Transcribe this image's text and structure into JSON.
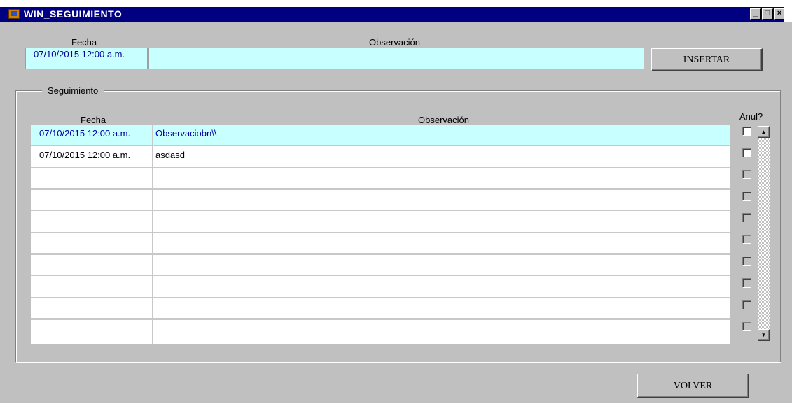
{
  "window": {
    "title": "WIN_SEGUIMIENTO",
    "minimize": "_",
    "maximize": "□",
    "close": "×"
  },
  "form": {
    "fecha_label": "Fecha",
    "observacion_label": "Observación",
    "fecha_value": "07/10/2015 12:00 a.m.",
    "observacion_value": "",
    "insert_button": "INSERTAR"
  },
  "seguimiento": {
    "group_label": "Seguimiento",
    "columns": {
      "fecha": "Fecha",
      "observacion": "Observación",
      "anulado": "Anul?"
    },
    "rows": [
      {
        "fecha": "07/10/2015 12:00 a.m.",
        "observacion": "Observaciobn\\\\"
      },
      {
        "fecha": "07/10/2015 12:00 a.m.",
        "observacion": "asdasd"
      },
      {
        "fecha": "",
        "observacion": ""
      },
      {
        "fecha": "",
        "observacion": ""
      },
      {
        "fecha": "",
        "observacion": ""
      },
      {
        "fecha": "",
        "observacion": ""
      },
      {
        "fecha": "",
        "observacion": ""
      },
      {
        "fecha": "",
        "observacion": ""
      },
      {
        "fecha": "",
        "observacion": ""
      },
      {
        "fecha": "",
        "observacion": ""
      }
    ]
  },
  "footer": {
    "back_button": "VOLVER"
  },
  "colors": {
    "window_bg": "#c0c0c0",
    "titlebar": "#000080",
    "field_highlight": "#c8ffff",
    "field_text": "#0000a0"
  },
  "icons": {
    "app": "app-icon",
    "scroll_up": "arrow-up-icon",
    "scroll_down": "arrow-down-icon"
  }
}
